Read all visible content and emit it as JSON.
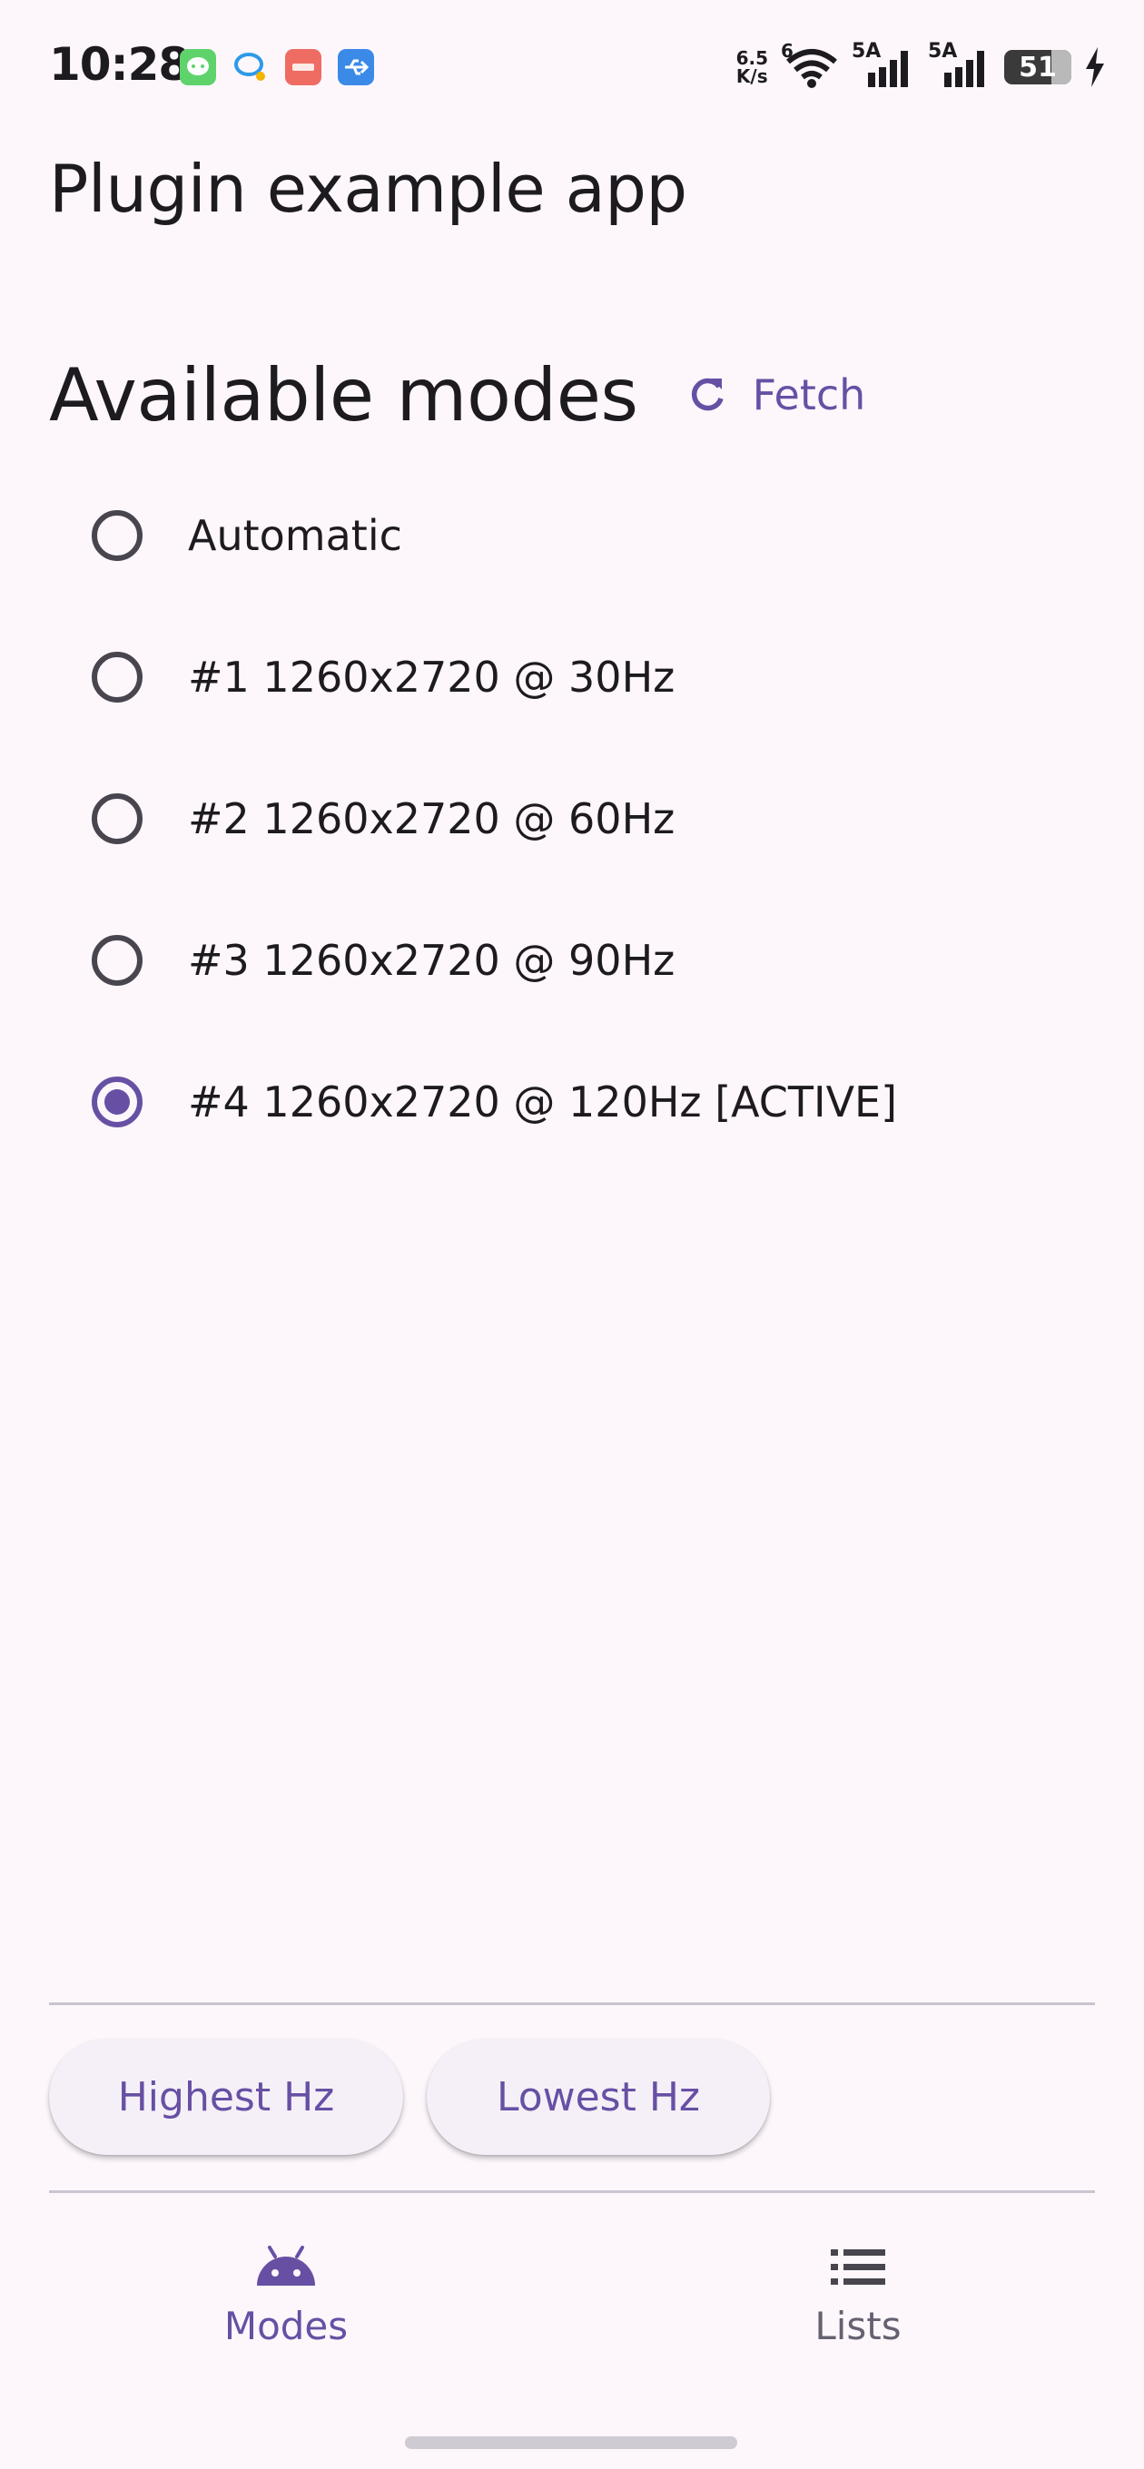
{
  "status_bar": {
    "time": "10:28",
    "net_speed_value": "6.5",
    "net_speed_unit": "K/s",
    "wifi_label": "6",
    "sim1_label": "5A",
    "sim2_label": "5A",
    "battery_level": "51",
    "notification_icons": [
      "message-app-icon",
      "chat-bubble-icon",
      "red-app-icon",
      "usb-icon"
    ]
  },
  "app_bar": {
    "title": "Plugin example app"
  },
  "modes_section": {
    "title": "Available modes",
    "fetch_label": "Fetch",
    "fetch_icon": "refresh-icon",
    "selected_index": 4,
    "options": [
      {
        "label": "Automatic"
      },
      {
        "label": "#1 1260x2720 @ 30Hz"
      },
      {
        "label": "#2 1260x2720 @ 60Hz"
      },
      {
        "label": "#3 1260x2720 @ 90Hz"
      },
      {
        "label": "#4 1260x2720 @ 120Hz [ACTIVE]"
      }
    ]
  },
  "actions": {
    "highest_label": "Highest Hz",
    "lowest_label": "Lowest Hz"
  },
  "bottom_nav": {
    "active": "modes",
    "items": [
      {
        "label": "Modes",
        "icon": "android-icon"
      },
      {
        "label": "Lists",
        "icon": "list-icon"
      }
    ]
  },
  "colors": {
    "primary": "#6750a4",
    "background": "#fdf7fc",
    "text": "#1d1b20",
    "divider": "#cac4d0"
  }
}
